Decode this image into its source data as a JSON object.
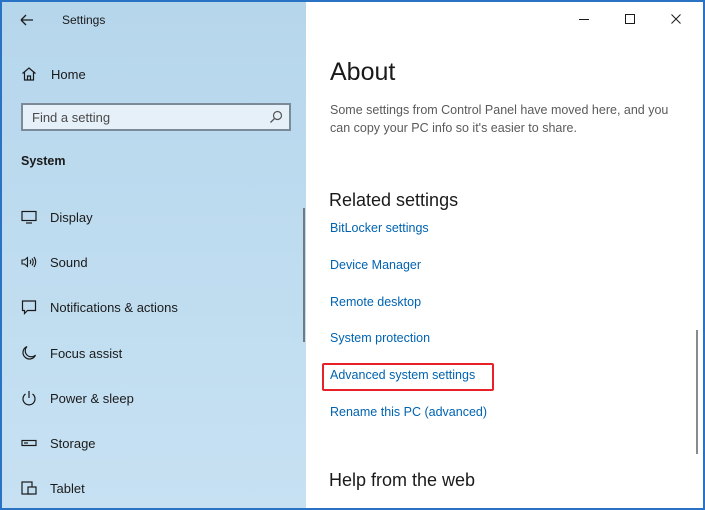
{
  "window": {
    "title": "Settings",
    "controls": [
      "minimize",
      "maximize",
      "close"
    ]
  },
  "sidebar": {
    "home_label": "Home",
    "search": {
      "placeholder": "Find a setting"
    },
    "section_label": "System",
    "items": [
      {
        "label": "Display",
        "icon": "display-icon"
      },
      {
        "label": "Sound",
        "icon": "speaker-icon"
      },
      {
        "label": "Notifications & actions",
        "icon": "notification-icon"
      },
      {
        "label": "Focus assist",
        "icon": "moon-icon"
      },
      {
        "label": "Power & sleep",
        "icon": "power-icon"
      },
      {
        "label": "Storage",
        "icon": "storage-icon"
      },
      {
        "label": "Tablet",
        "icon": "tablet-icon"
      }
    ]
  },
  "main": {
    "title": "About",
    "description": "Some settings from Control Panel have moved here, and you can copy your PC info so it's easier to share.",
    "related_heading": "Related settings",
    "related_links": [
      "BitLocker settings",
      "Device Manager",
      "Remote desktop",
      "System protection",
      "Advanced system settings",
      "Rename this PC (advanced)"
    ],
    "highlighted_link": "Advanced system settings",
    "help_heading": "Help from the web"
  },
  "colors": {
    "accent": "#2a72c4",
    "link": "#0063b1",
    "highlight": "#e8202a",
    "sidebar_bg": "#bddbef"
  }
}
